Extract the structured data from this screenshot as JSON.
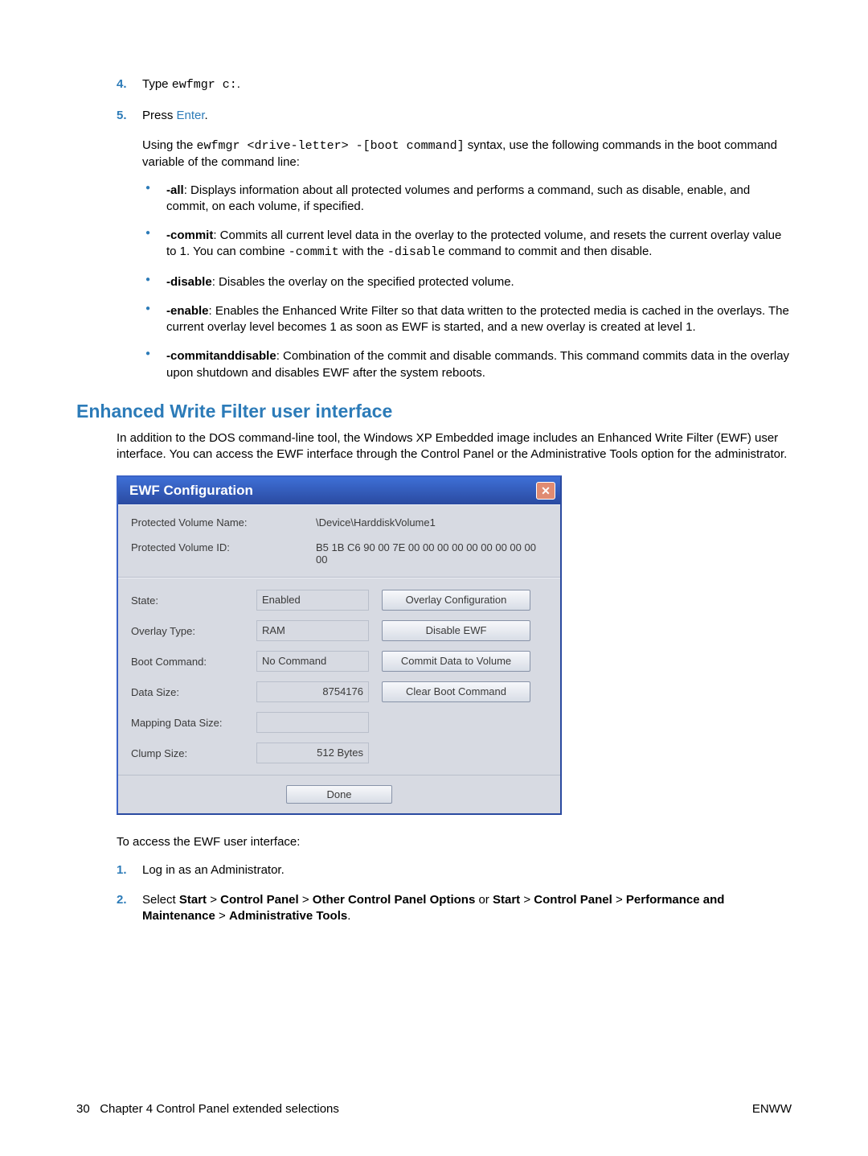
{
  "steps_top": [
    {
      "num": "4.",
      "text_pre": "Type ",
      "code": "ewfmgr c:",
      "text_post": "."
    },
    {
      "num": "5.",
      "text_pre": "Press ",
      "link": "Enter",
      "text_post": "."
    }
  ],
  "syntax_para": {
    "pre": "Using the ",
    "code": "ewfmgr <drive-letter> -[boot command]",
    "post": " syntax, use the following commands in the boot command variable of the command line:"
  },
  "bullets": [
    {
      "bold": "-all",
      "text": ": Displays information about all protected volumes and performs a command, such as disable, enable, and commit, on each volume, if specified."
    },
    {
      "bold": "-commit",
      "text": ": Commits all current level data in the overlay to the protected volume, and resets the current overlay value to 1. You can combine ",
      "code1": "-commit",
      "mid": " with the ",
      "code2": "-disable",
      "tail": " command to commit and then disable."
    },
    {
      "bold": "-disable",
      "text": ": Disables the overlay on the specified protected volume."
    },
    {
      "bold": "-enable",
      "text": ": Enables the Enhanced Write Filter so that data written to the protected media is cached in the overlays. The current overlay level becomes 1 as soon as EWF is started, and a new overlay is created at level 1."
    },
    {
      "bold": "-commitanddisable",
      "text": ": Combination of the commit and disable commands. This command commits data in the overlay upon shutdown and disables EWF after the system reboots."
    }
  ],
  "heading": "Enhanced Write Filter user interface",
  "intro_para": "In addition to the DOS command-line tool, the Windows XP Embedded image includes an Enhanced Write Filter (EWF) user interface. You can access the EWF interface through the Control Panel or the Administrative Tools option for the administrator.",
  "ewf": {
    "title": "EWF Configuration",
    "close": "✕",
    "vol_name_lbl": "Protected Volume Name:",
    "vol_name_val": "\\Device\\HarddiskVolume1",
    "vol_id_lbl": "Protected Volume ID:",
    "vol_id_val": "B5 1B C6 90 00 7E 00 00 00 00 00 00 00 00 00 00",
    "state_lbl": "State:",
    "state_val": "Enabled",
    "overlay_type_lbl": "Overlay Type:",
    "overlay_type_val": "RAM",
    "boot_cmd_lbl": "Boot Command:",
    "boot_cmd_val": "No Command",
    "data_size_lbl": "Data Size:",
    "data_size_val": "8754176",
    "mapping_lbl": "Mapping Data Size:",
    "mapping_val": "",
    "clump_lbl": "Clump Size:",
    "clump_val": "512 Bytes",
    "btn_overlay": "Overlay Configuration",
    "btn_disable": "Disable EWF",
    "btn_commit": "Commit Data to Volume",
    "btn_clear": "Clear Boot Command",
    "btn_done": "Done"
  },
  "access_text": "To access the EWF user interface:",
  "steps_bottom": [
    {
      "num": "1.",
      "parts": [
        {
          "t": "Log in as an Administrator."
        }
      ]
    },
    {
      "num": "2.",
      "parts": [
        {
          "t": "Select "
        },
        {
          "b": "Start"
        },
        {
          "t": " > "
        },
        {
          "b": "Control Panel"
        },
        {
          "t": " > "
        },
        {
          "b": "Other Control Panel Options"
        },
        {
          "t": " or "
        },
        {
          "b": "Start"
        },
        {
          "t": " > "
        },
        {
          "b": "Control Panel"
        },
        {
          "t": " > "
        },
        {
          "b": "Performance and Maintenance"
        },
        {
          "t": " > "
        },
        {
          "b": "Administrative Tools"
        },
        {
          "t": "."
        }
      ]
    }
  ],
  "footer": {
    "page": "30",
    "chapter": "Chapter 4   Control Panel extended selections",
    "right": "ENWW"
  }
}
